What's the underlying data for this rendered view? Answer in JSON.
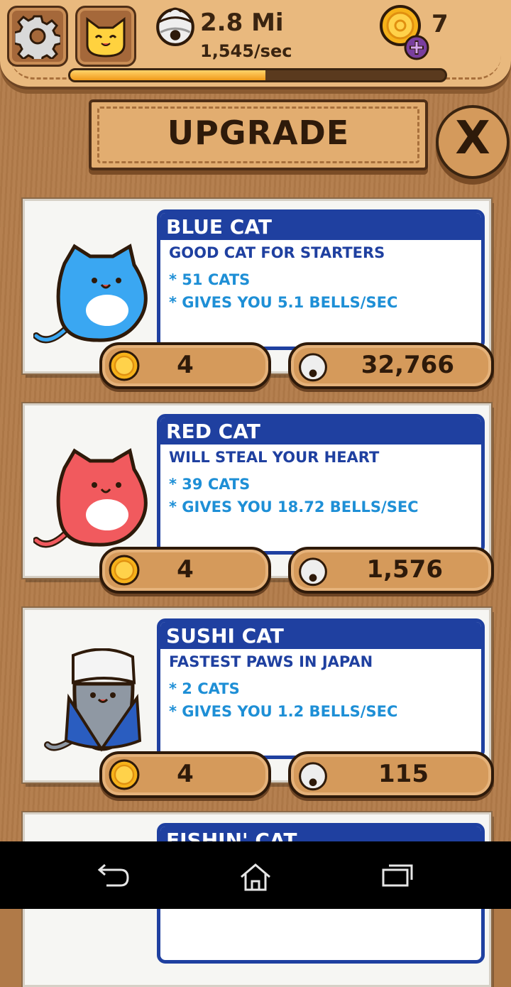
{
  "header": {
    "bells_total": "2.8 Mi",
    "bells_rate": "1,545/sec",
    "coins": "7",
    "progress_fraction": 0.52
  },
  "title": "UPGRADE",
  "close_label": "X",
  "cards": [
    {
      "name": "BLUE CAT",
      "desc": "GOOD CAT FOR STARTERS",
      "line1": "* 51 CATS",
      "line2": "* GIVES YOU 5.1 BELLS/SEC",
      "coin_price": "4",
      "bell_price": "32,766",
      "color": "#3aa7f2"
    },
    {
      "name": "RED CAT",
      "desc": "WILL STEAL YOUR HEART",
      "line1": "* 39 CATS",
      "line2": "* GIVES YOU 18.72 BELLS/SEC",
      "coin_price": "4",
      "bell_price": "1,576",
      "color": "#f15a5e"
    },
    {
      "name": "SUSHI CAT",
      "desc": "FASTEST PAWS IN JAPAN",
      "line1": "* 2 CATS",
      "line2": "* GIVES YOU 1.2 BELLS/SEC",
      "coin_price": "4",
      "bell_price": "115",
      "color": "#8f98a3"
    },
    {
      "name": "FISHIN' CAT"
    }
  ],
  "icons": [
    "gear-icon",
    "cat-face-icon",
    "bell-icon",
    "gold-coin-icon",
    "plus-icon",
    "close-icon",
    "back-icon",
    "home-icon",
    "recents-icon"
  ]
}
